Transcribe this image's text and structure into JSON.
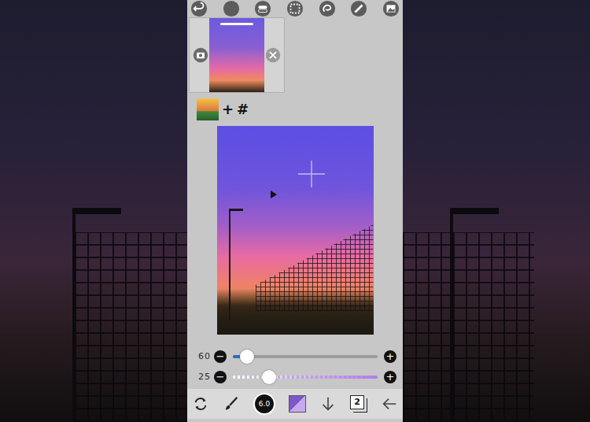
{
  "reference": {
    "plus": "+",
    "hash": "#"
  },
  "sliders": [
    {
      "kind": "size",
      "reading": "60",
      "minus": "−",
      "plus": "+",
      "level": 0.1
    },
    {
      "kind": "opacity",
      "reading": "25",
      "minus": "−",
      "plus": "+",
      "level": 0.25
    }
  ],
  "brush": {
    "size": "6.0"
  },
  "layers": {
    "count": "2"
  }
}
